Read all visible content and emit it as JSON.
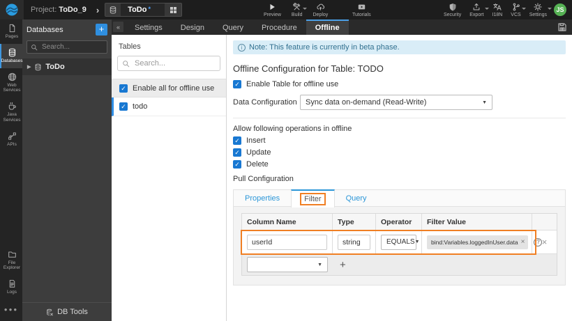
{
  "topbar": {
    "project_prefix": "Project:",
    "project_name": "ToDo_9",
    "nav_chevron": "›",
    "artifact_name": "ToDo",
    "dirty_indicator": "*",
    "preview_label": "Preview",
    "build_label": "Build",
    "deploy_label": "Deploy",
    "tutorials_label": "Tutorials",
    "security_label": "Security",
    "export_label": "Export",
    "i18n_label": "I18N",
    "vcs_label": "VCS",
    "settings_label": "Settings",
    "avatar_initials": "JS"
  },
  "sidebar": {
    "items": [
      {
        "label": "Pages"
      },
      {
        "label": "Databases"
      },
      {
        "label": "Web Services"
      },
      {
        "label": "Java Services"
      },
      {
        "label": "APIs"
      },
      {
        "label": "File Explorer"
      },
      {
        "label": "Logs"
      }
    ],
    "overflow": "●●●"
  },
  "db_panel": {
    "title": "Databases",
    "add_button": "+",
    "search_placeholder": "Search...",
    "collapse_button": "«",
    "tree_caret": "▶",
    "tree_item": "ToDo",
    "footer_label": "DB Tools"
  },
  "tabbar": {
    "tabs": [
      "Settings",
      "Design",
      "Query",
      "Procedure",
      "Offline"
    ],
    "active_tab": "Offline"
  },
  "tables_panel": {
    "title": "Tables",
    "search_placeholder": "Search...",
    "enable_all_label": "Enable all for offline use",
    "table_name": "todo"
  },
  "main": {
    "note_text": "Note: This feature is currently in beta phase.",
    "heading": "Offline Configuration for Table: TODO",
    "enable_table_label": "Enable Table for offline use",
    "data_config_label": "Data Configuration",
    "data_config_value": "Sync data on-demand (Read-Write)",
    "allow_ops_label": "Allow following operations in offline",
    "op_insert": "Insert",
    "op_update": "Update",
    "op_delete": "Delete",
    "pull_config_label": "Pull Configuration",
    "subtabs": {
      "properties": "Properties",
      "filter": "Filter",
      "query": "Query"
    }
  },
  "filter_table": {
    "headers": {
      "column": "Column Name",
      "type": "Type",
      "operator": "Operator",
      "value": "Filter Value"
    },
    "row": {
      "column_name": "userId",
      "type": "string",
      "operator": "EQUALS",
      "value": "bind:Variables.loggedInUser.data"
    },
    "add_button": "+"
  },
  "colors": {
    "accent_blue": "#2b96d8",
    "annotation_orange": "#f07f23",
    "note_bg": "#d9edf7",
    "avatar_green": "#56b154",
    "checkbox_blue": "#1878d2"
  }
}
